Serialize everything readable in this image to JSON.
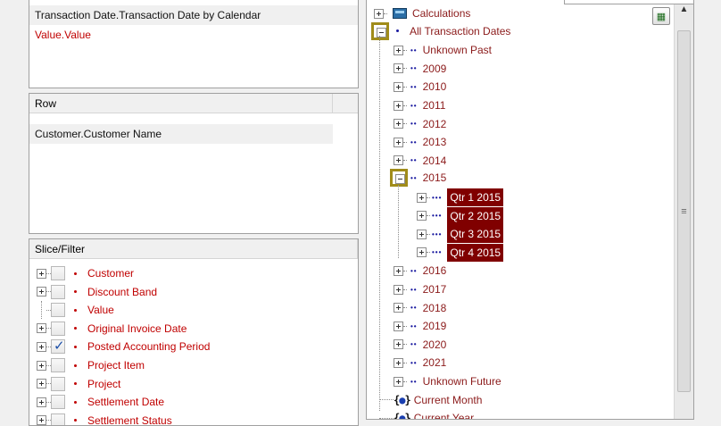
{
  "columns_panel": {
    "fields": [
      {
        "label": "Transaction Date.Transaction Date by Calendar",
        "color": "black"
      },
      {
        "label": "Value.Value",
        "color": "red"
      }
    ]
  },
  "row_panel": {
    "header": "Row",
    "fields": [
      {
        "label": "Customer.Customer Name",
        "color": "black"
      }
    ]
  },
  "slice_panel": {
    "header": "Slice/Filter",
    "items": [
      {
        "label": "Customer",
        "checked": false,
        "expandable": true
      },
      {
        "label": "Discount Band",
        "checked": false,
        "expandable": true
      },
      {
        "label": "Value",
        "checked": false,
        "expandable": false
      },
      {
        "label": "Original Invoice Date",
        "checked": false,
        "expandable": true
      },
      {
        "label": "Posted Accounting Period",
        "checked": true,
        "expandable": true
      },
      {
        "label": "Project Item",
        "checked": false,
        "expandable": true
      },
      {
        "label": "Project",
        "checked": false,
        "expandable": true
      },
      {
        "label": "Settlement Date",
        "checked": false,
        "expandable": true
      },
      {
        "label": "Settlement Status",
        "checked": false,
        "expandable": true
      }
    ]
  },
  "tree_panel": {
    "calculations": "Calculations",
    "all_dates": "All Transaction Dates",
    "unknown_past": "Unknown Past",
    "years_before": [
      "2009",
      "2010",
      "2011",
      "2012",
      "2013",
      "2014"
    ],
    "expanded_year": "2015",
    "quarters": [
      "Qtr 1 2015",
      "Qtr 2 2015",
      "Qtr 3 2015",
      "Qtr 4 2015"
    ],
    "years_after": [
      "2016",
      "2017",
      "2018",
      "2019",
      "2020",
      "2021"
    ],
    "unknown_future": "Unknown Future",
    "current_month": "Current Month",
    "current_year": "Current Year"
  },
  "colors": {
    "highlight_box": "#a08c1a",
    "selected_bg": "#800000",
    "member_text": "#8b1a1a",
    "filter_text": "#c00000"
  },
  "icons": {
    "tree_toggle": "toggle-tree-button-icon",
    "scroll_thumb_grip": "≡",
    "scroll_up": "▲"
  }
}
